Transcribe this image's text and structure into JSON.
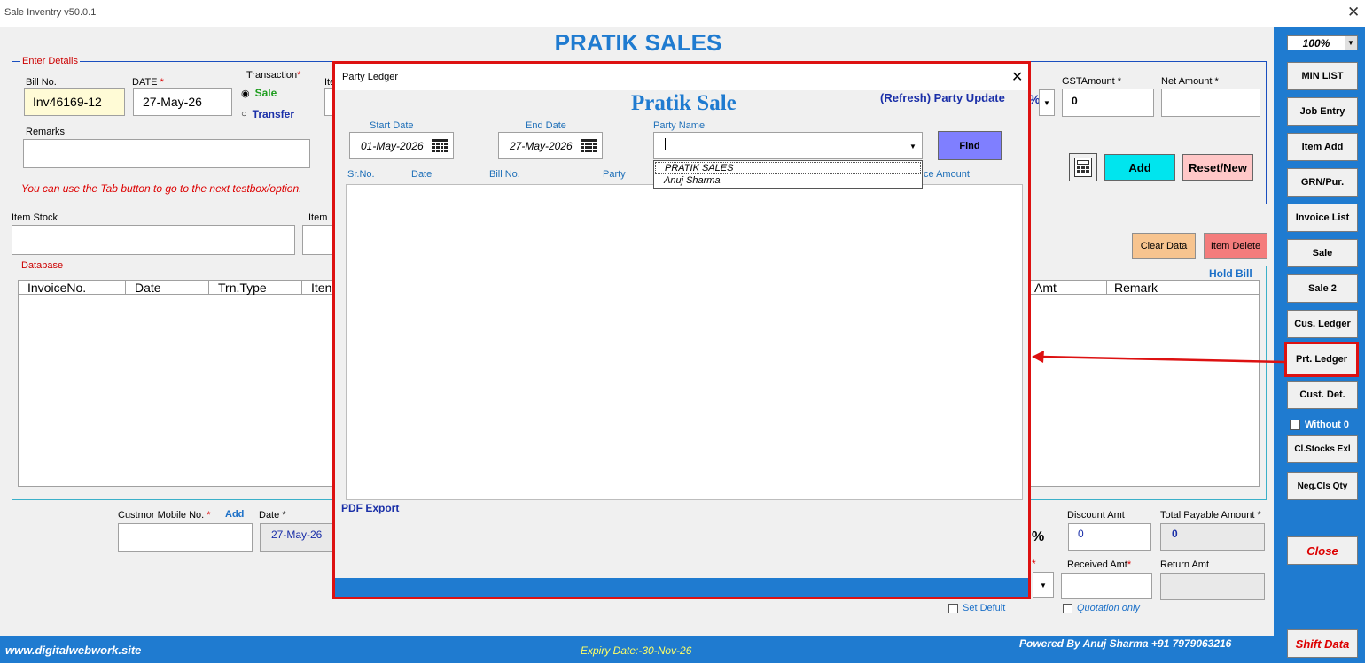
{
  "window": {
    "title": "Sale Inventry v50.0.1",
    "close": "✕"
  },
  "brand": "PRATIK SALES",
  "enter_details": {
    "legend": "Enter Details",
    "bill_no_label": "Bill No.",
    "bill_no": "Inv46169-12",
    "date_label": "DATE",
    "date": "27-May-26",
    "transaction_label": "Transaction",
    "sale": "Sale",
    "transfer": "Transfer",
    "item_label_stub": "Ite",
    "remarks_label": "Remarks",
    "hint": "You can use the Tab button to go to the next testbox/option.",
    "gst_amount_label": "GSTAmount",
    "gst_amount": "0",
    "net_amount_label": "Net Amount",
    "percent": "%",
    "add": "Add",
    "reset": "Reset/New"
  },
  "required_mark": "*",
  "item_stock_label": "Item Stock",
  "item_stub": "Item",
  "clear_data": "Clear Data",
  "item_delete": "Item Delete",
  "database": {
    "legend": "Database",
    "hold_bill": "Hold Bill",
    "columns_left": [
      "InvoiceNo.",
      "Date",
      "Trn.Type",
      "Iten"
    ],
    "columns_right": [
      "Amt",
      "Remark"
    ]
  },
  "bottom": {
    "mobile_label": "Custmor Mobile No.",
    "add": "Add",
    "date_label": "Date",
    "date": "27-May-26",
    "percent": "%",
    "discount_label": "Discount Amt",
    "discount": "0",
    "total_label": "Total Payable Amount",
    "total": "0",
    "received_label": "Received Amt",
    "return_label": "Return Amt",
    "set_default": "Set Defult",
    "quotation_only": "Quotation only"
  },
  "sidebar": {
    "zoom": "100%",
    "items": [
      "MIN LIST",
      "Job Entry",
      "Item Add",
      "GRN/Pur.",
      "Invoice List",
      "Sale",
      "Sale 2",
      "Cus. Ledger",
      "Prt. Ledger",
      "Cust. Det."
    ],
    "without0": "Without 0",
    "cl_stocks": "Cl.Stocks Exl",
    "neg_cls": "Neg.Cls Qty",
    "close": "Close",
    "shift_data": "Shift Data"
  },
  "footer": {
    "site": "www.digitalwebwork.site",
    "expiry": "Expiry Date:-30-Nov-26",
    "powered": "Powered By Anuj Sharma +91 7979063216"
  },
  "dialog": {
    "title": "Party Ledger",
    "close": "✕",
    "heading": "Pratik Sale",
    "refresh": "(Refresh) Party Update",
    "start_date_label": "Start Date",
    "start_date": "01-May-2026",
    "end_date_label": "End Date",
    "end_date": "27-May-2026",
    "party_name_label": "Party Name",
    "find": "Find",
    "columns": [
      "Sr.No.",
      "Date",
      "Bill No.",
      "Party"
    ],
    "column_right": "ce Amount",
    "dropdown_options": [
      "PRATIK SALES",
      "Anuj Sharma"
    ],
    "pdf_export": "PDF Export"
  },
  "colors": {
    "accent_blue": "#1f7bd0",
    "highlight_red": "#d11111",
    "add_cyan": "#00e5ee",
    "find_purple": "#7f7fff"
  }
}
